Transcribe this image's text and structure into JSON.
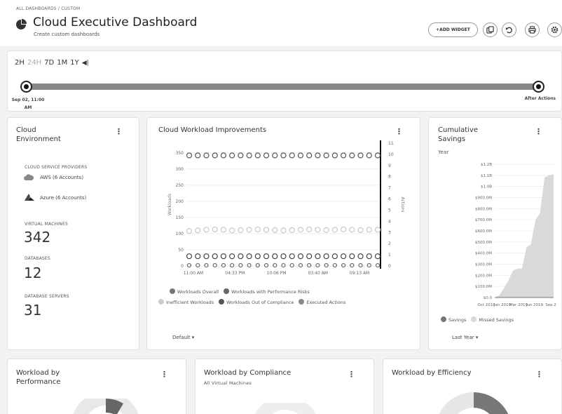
{
  "header": {
    "breadcrumb": "ALL DASHBOARDS / CUSTOM",
    "title": "Cloud Executive Dashboard",
    "subtitle": "Create custom dashboards",
    "add_widget": "+ADD WIDGET",
    "icons": [
      "copy-icon",
      "undo-icon",
      "print-icon",
      "gear-icon"
    ]
  },
  "timeline": {
    "ranges": [
      "2H",
      "24H",
      "7D",
      "1M",
      "1Y"
    ],
    "selected_range": "24H",
    "start_label_line1": "Sep 02, 11:00",
    "start_label_line2": "AM",
    "end_label": "After Actions"
  },
  "cloud_env": {
    "title_line1": "Cloud",
    "title_line2": "Environment",
    "providers_label": "CLOUD SERVICE PROVIDERS",
    "aws": "AWS (6 Accounts)",
    "azure": "Azure (6 Accounts)",
    "vm_label": "VIRTUAL MACHINES",
    "vm_count": "342",
    "db_label": "DATABASES",
    "db_count": "12",
    "dbs_label": "DATABASE SERVERS",
    "dbs_count": "31"
  },
  "improvements": {
    "title": "Cloud Workload Improvements",
    "y_label_left": "Workloads",
    "y_label_right": "Actions",
    "legend": [
      {
        "label": "Workloads Overall",
        "color": "#777777"
      },
      {
        "label": "Workloads with Performance Risks",
        "color": "#666666"
      },
      {
        "label": "Inefficient Workloads",
        "color": "#cccccc"
      },
      {
        "label": "Workloads Out of Compliance",
        "color": "#555555"
      },
      {
        "label": "Executed Actions",
        "color": "#888888"
      }
    ],
    "dropdown": "Default ▾"
  },
  "savings": {
    "title_line1": "Cumulative",
    "title_line2": "Savings",
    "period": "Year",
    "legend": [
      {
        "label": "Savings",
        "color": "#777777"
      },
      {
        "label": "Missed Savings",
        "color": "#d9d9d9"
      }
    ],
    "dropdown": "Last Year ▾"
  },
  "bottom": {
    "performance_line1": "Workload by",
    "performance_line2": "Performance",
    "compliance_title": "Workload by Compliance",
    "compliance_sub": "All Virtual Machines",
    "efficiency_title": "Workload by Efficiency"
  },
  "chart_data": [
    {
      "type": "line",
      "title": "Cloud Workload Improvements",
      "x_ticks": [
        "11:00 AM",
        "04:33 PM",
        "10:06 PM",
        "03:40 AM",
        "09:13 AM"
      ],
      "y_ticks_left": [
        "0",
        "50",
        "100",
        "150",
        "200",
        "250",
        "300",
        "350"
      ],
      "y_ticks_right": [
        "0",
        "1",
        "2",
        "3",
        "4",
        "5",
        "6",
        "7",
        "8",
        "9",
        "10",
        "11"
      ],
      "ylim_left": [
        0,
        380
      ],
      "ylim_right": [
        0,
        11
      ],
      "series": [
        {
          "name": "Workloads Overall",
          "values": [
            342,
            342,
            342,
            342,
            342,
            342,
            342,
            342,
            342,
            342,
            342,
            342,
            342,
            342,
            342,
            342,
            342,
            342,
            342,
            342,
            342,
            342,
            342
          ]
        },
        {
          "name": "Inefficient Workloads",
          "values": [
            108,
            110,
            112,
            113,
            112,
            110,
            111,
            112,
            113,
            112,
            111,
            110,
            111,
            112,
            113,
            112,
            111,
            112,
            113,
            112,
            111,
            112,
            112
          ]
        },
        {
          "name": "Workloads Out of Compliance",
          "values": [
            30,
            30,
            30,
            30,
            30,
            30,
            30,
            30,
            30,
            30,
            30,
            30,
            30,
            30,
            30,
            30,
            30,
            30,
            30,
            30,
            30,
            30,
            30
          ]
        },
        {
          "name": "Workloads with Performance Risks",
          "values": [
            2,
            2,
            2,
            2,
            2,
            2,
            2,
            2,
            2,
            2,
            2,
            2,
            2,
            2,
            2,
            2,
            2,
            2,
            2,
            2,
            2,
            2,
            2
          ]
        }
      ]
    },
    {
      "type": "area",
      "title": "Cumulative Savings",
      "y_ticks": [
        "$0.0",
        "$100.0M",
        "$200.0M",
        "$300.0M",
        "$400.0M",
        "$500.0M",
        "$600.0M",
        "$700.0M",
        "$800.0M",
        "$900.0M",
        "$1.0B",
        "$1.1B",
        "$1.2B"
      ],
      "x_ticks": [
        "Oct 2018",
        "Jan 2019",
        "Mar 2019",
        "Jun 2019",
        "Sep 2"
      ],
      "ylim": [
        0,
        1200
      ],
      "series": [
        {
          "name": "Savings",
          "values": [
            0,
            0
          ]
        },
        {
          "name": "Missed Savings",
          "values": [
            0,
            20,
            80,
            150,
            240,
            260,
            260,
            450,
            480,
            700,
            760,
            1080,
            1100,
            1110
          ]
        }
      ]
    }
  ]
}
